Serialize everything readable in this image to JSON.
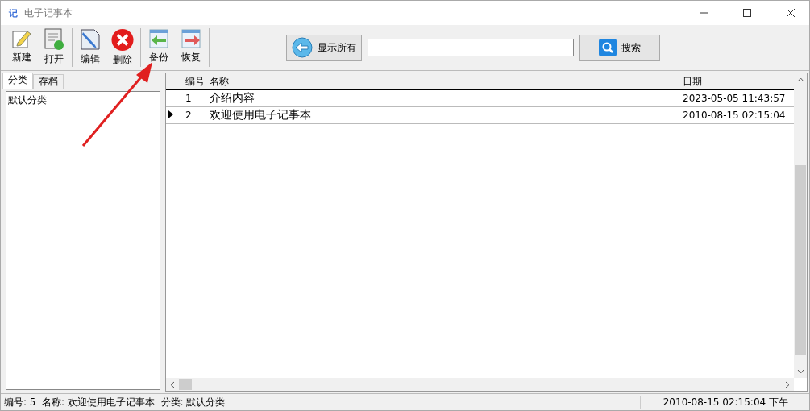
{
  "window": {
    "icon_text": "记",
    "title": "电子记事本"
  },
  "toolbar": {
    "groups": [
      [
        {
          "label": "新建"
        },
        {
          "label": "打开"
        }
      ],
      [
        {
          "label": "编辑"
        },
        {
          "label": "删除"
        }
      ],
      [
        {
          "label": "备份"
        },
        {
          "label": "恢复"
        }
      ]
    ],
    "show_all_button": "显示所有",
    "search_button": "搜索"
  },
  "sidebar": {
    "tabs": [
      {
        "label": "分类",
        "selected": true
      },
      {
        "label": "存档",
        "selected": false
      }
    ],
    "items": [
      {
        "label": "默认分类",
        "selected": false
      }
    ]
  },
  "table": {
    "columns": [
      "编号",
      "名称",
      "日期"
    ],
    "rows": [
      {
        "number": "1",
        "name": "介绍内容",
        "date": "2023-05-05 11:43:57",
        "current": false
      },
      {
        "number": "2",
        "name": "欢迎使用电子记事本",
        "date": "2010-08-15 02:15:04",
        "current": true
      }
    ]
  },
  "status_bar": {
    "left": "编号: 5  名称: 欢迎使用电子记事本  分类: 默认分类",
    "right": "2010-08-15 02:15:04 下午"
  }
}
